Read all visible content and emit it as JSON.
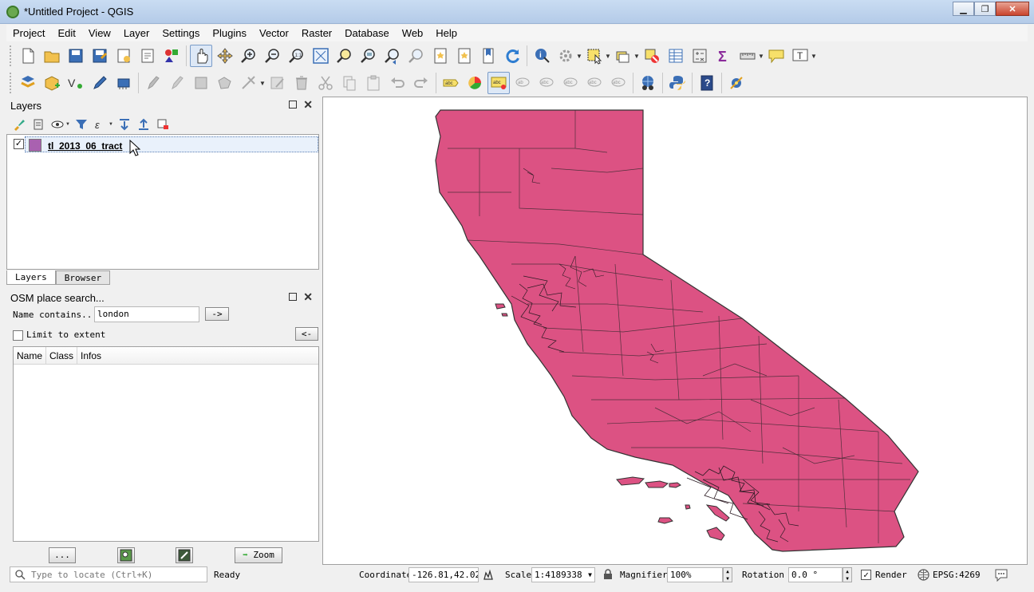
{
  "window": {
    "title": "*Untitled Project - QGIS"
  },
  "menu": [
    "Project",
    "Edit",
    "View",
    "Layer",
    "Settings",
    "Plugins",
    "Vector",
    "Raster",
    "Database",
    "Web",
    "Help"
  ],
  "layers_panel": {
    "title": "Layers",
    "layer": {
      "name": "tl_2013_06_tract",
      "visible": true,
      "color": "#a961b0"
    }
  },
  "tabs": [
    "Layers",
    "Browser"
  ],
  "osm": {
    "title": "OSM place search...",
    "name_label": "Name contains...",
    "name_value": "london",
    "go_label": "->",
    "limit_label": "Limit to extent",
    "back_label": "<-",
    "columns": [
      "Name",
      "Class",
      "Infos"
    ],
    "more_label": "...",
    "zoom_label": "Zoom"
  },
  "map": {
    "fill_color": "#dc5283",
    "outline_color": "#333333"
  },
  "status": {
    "locator_placeholder": "Type to locate (Ctrl+K)",
    "ready": "Ready",
    "coordinate_label": "Coordinate",
    "coordinate_value": "-126.81,42.02",
    "scale_label": "Scale",
    "scale_value": "1:4189338",
    "magnifier_label": "Magnifier",
    "magnifier_value": "100%",
    "rotation_label": "Rotation",
    "rotation_value": "0.0 °",
    "render_label": "Render",
    "crs": "EPSG:4269"
  }
}
